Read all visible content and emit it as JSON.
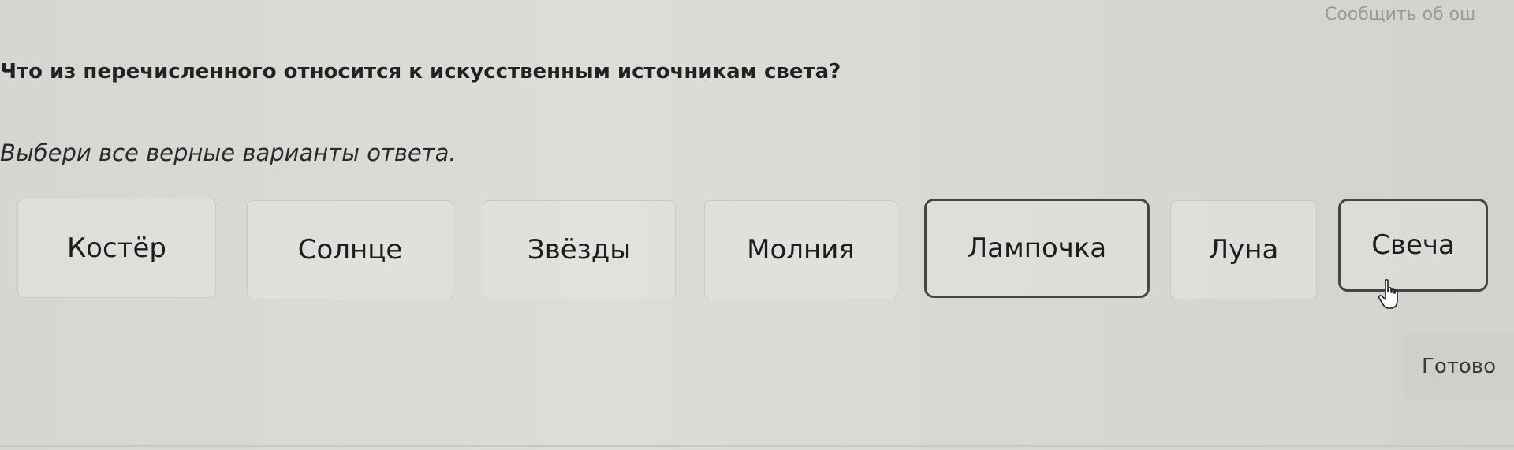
{
  "report_link": "Сообщить об ош",
  "question": "Что из перечисленного относится к искусственным источникам света?",
  "instruction": "Выбери все верные варианты ответа.",
  "options": [
    {
      "label": "Костёр",
      "selected": false
    },
    {
      "label": "Солнце",
      "selected": false
    },
    {
      "label": "Звёзды",
      "selected": false
    },
    {
      "label": "Молния",
      "selected": false
    },
    {
      "label": "Лампочка",
      "selected": true
    },
    {
      "label": "Луна",
      "selected": false
    },
    {
      "label": "Свеча",
      "selected": true
    }
  ],
  "done_button": "Готово"
}
